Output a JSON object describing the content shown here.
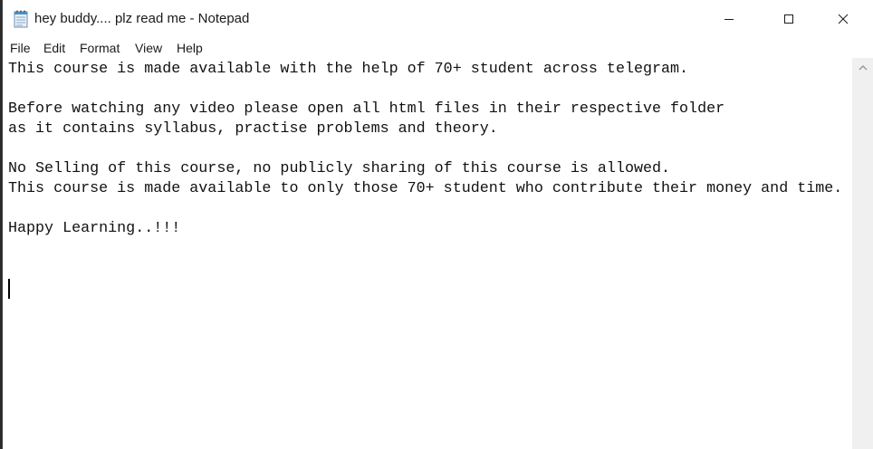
{
  "window": {
    "title": "hey buddy.... plz read me - Notepad"
  },
  "menu": {
    "items": [
      {
        "label": "File"
      },
      {
        "label": "Edit"
      },
      {
        "label": "Format"
      },
      {
        "label": "View"
      },
      {
        "label": "Help"
      }
    ]
  },
  "editor": {
    "lines": [
      "This course is made available with the help of 70+ student across telegram.",
      "",
      "Before watching any video please open all html files in their respective folder",
      "as it contains syllabus, practise problems and theory.",
      "",
      "No Selling of this course, no publicly sharing of this course is allowed.",
      "This course is made available to only those 70+ student who contribute their money and time.",
      "",
      "Happy Learning..!!!"
    ]
  },
  "icons": {
    "app": "notepad-icon",
    "minimize": "minimize-icon",
    "maximize": "maximize-icon",
    "close": "close-icon",
    "scroll_up": "scroll-up-arrow-icon"
  }
}
